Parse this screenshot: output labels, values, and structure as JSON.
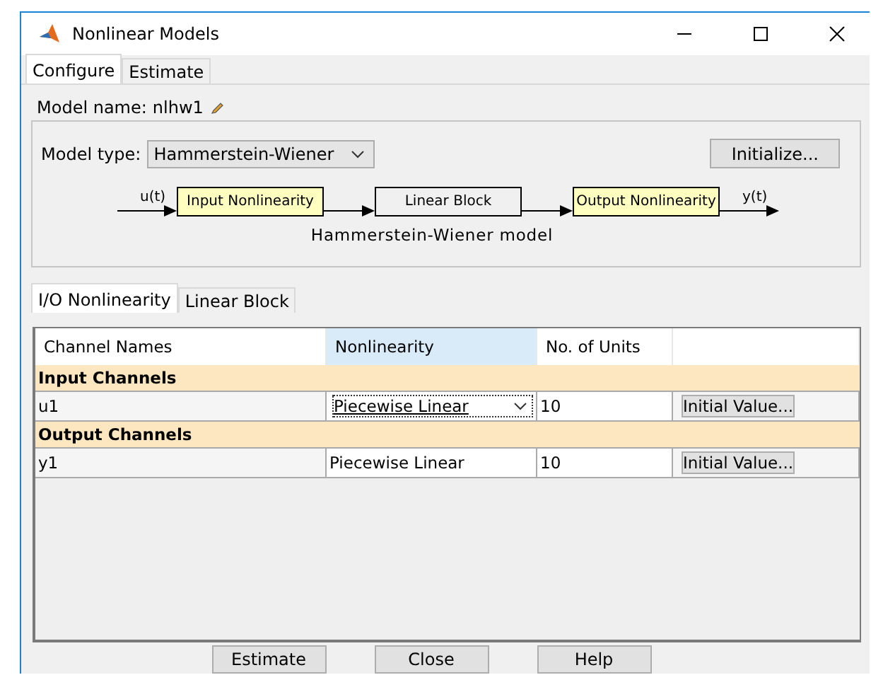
{
  "window": {
    "title": "Nonlinear Models"
  },
  "tabs": [
    {
      "label": "Configure",
      "selected": true
    },
    {
      "label": "Estimate",
      "selected": false
    }
  ],
  "model_name": {
    "label": "Model name:",
    "value": "nlhw1"
  },
  "model_type": {
    "label": "Model type:",
    "value": "Hammerstein-Wiener"
  },
  "initialize_button": "Initialize...",
  "diagram": {
    "input_signal": "u(t)",
    "output_signal": "y(t)",
    "blocks": [
      {
        "label": "Input Nonlinearity",
        "kind": "nonlinear"
      },
      {
        "label": "Linear Block",
        "kind": "linear"
      },
      {
        "label": "Output Nonlinearity",
        "kind": "nonlinear"
      }
    ],
    "caption": "Hammerstein-Wiener model"
  },
  "subtabs": [
    {
      "label": "I/O Nonlinearity",
      "selected": true
    },
    {
      "label": "Linear Block",
      "selected": false
    }
  ],
  "table": {
    "columns": [
      {
        "label": "Channel Names",
        "selected": false
      },
      {
        "label": "Nonlinearity",
        "selected": true
      },
      {
        "label": "No. of Units",
        "selected": false
      }
    ],
    "groups": [
      {
        "title": "Input Channels",
        "rows": [
          {
            "channel": "u1",
            "nonlinearity": "Piecewise Linear",
            "kind": "dropdown",
            "units": "10",
            "button": "Initial Value..."
          }
        ]
      },
      {
        "title": "Output Channels",
        "rows": [
          {
            "channel": "y1",
            "nonlinearity": "Piecewise Linear",
            "kind": "text",
            "units": "10",
            "button": "Initial Value..."
          }
        ]
      }
    ]
  },
  "buttons": [
    "Estimate",
    "Close",
    "Help"
  ]
}
